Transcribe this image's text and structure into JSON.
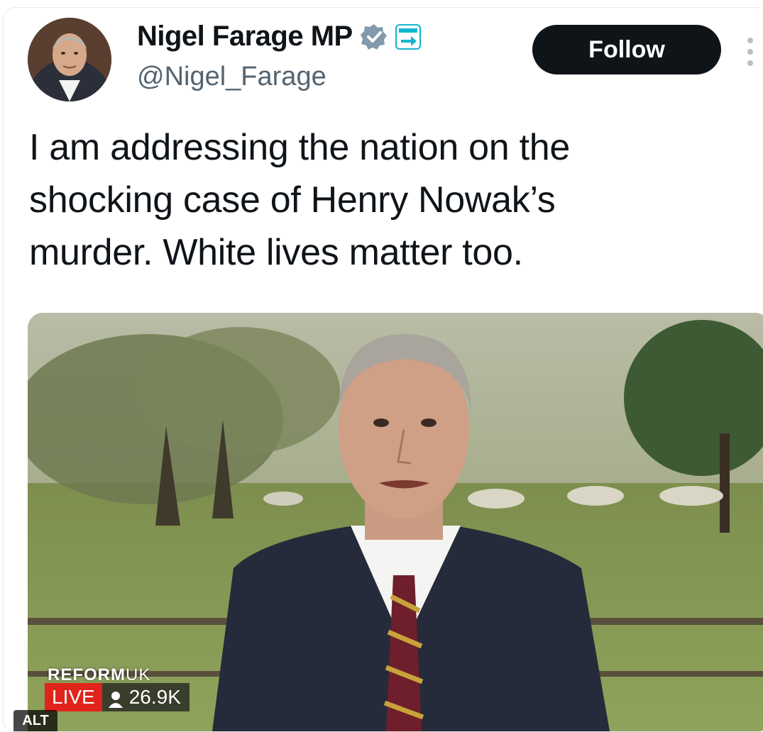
{
  "author": {
    "display_name": "Nigel Farage MP",
    "handle": "@Nigel_Farage",
    "verified_icon": "verified-badge-icon",
    "affiliate_icon": "reform-affiliate-icon"
  },
  "follow_button": {
    "label": "Follow"
  },
  "more_menu": {
    "icon": "more-vertical-icon"
  },
  "tweet": {
    "lines": [
      "I am addressing the nation on the",
      "shocking case of Henry Nowak’s",
      "murder. White lives matter too."
    ]
  },
  "media": {
    "logo_main": "REFORM",
    "logo_suffix": "UK",
    "live_label": "LIVE",
    "viewer_count": "26.9K",
    "alt_label": "ALT"
  },
  "colors": {
    "follow_bg": "#0f1419",
    "verified_blue": "#829aab",
    "live_red": "#e0241b",
    "handle_gray": "#536471"
  }
}
